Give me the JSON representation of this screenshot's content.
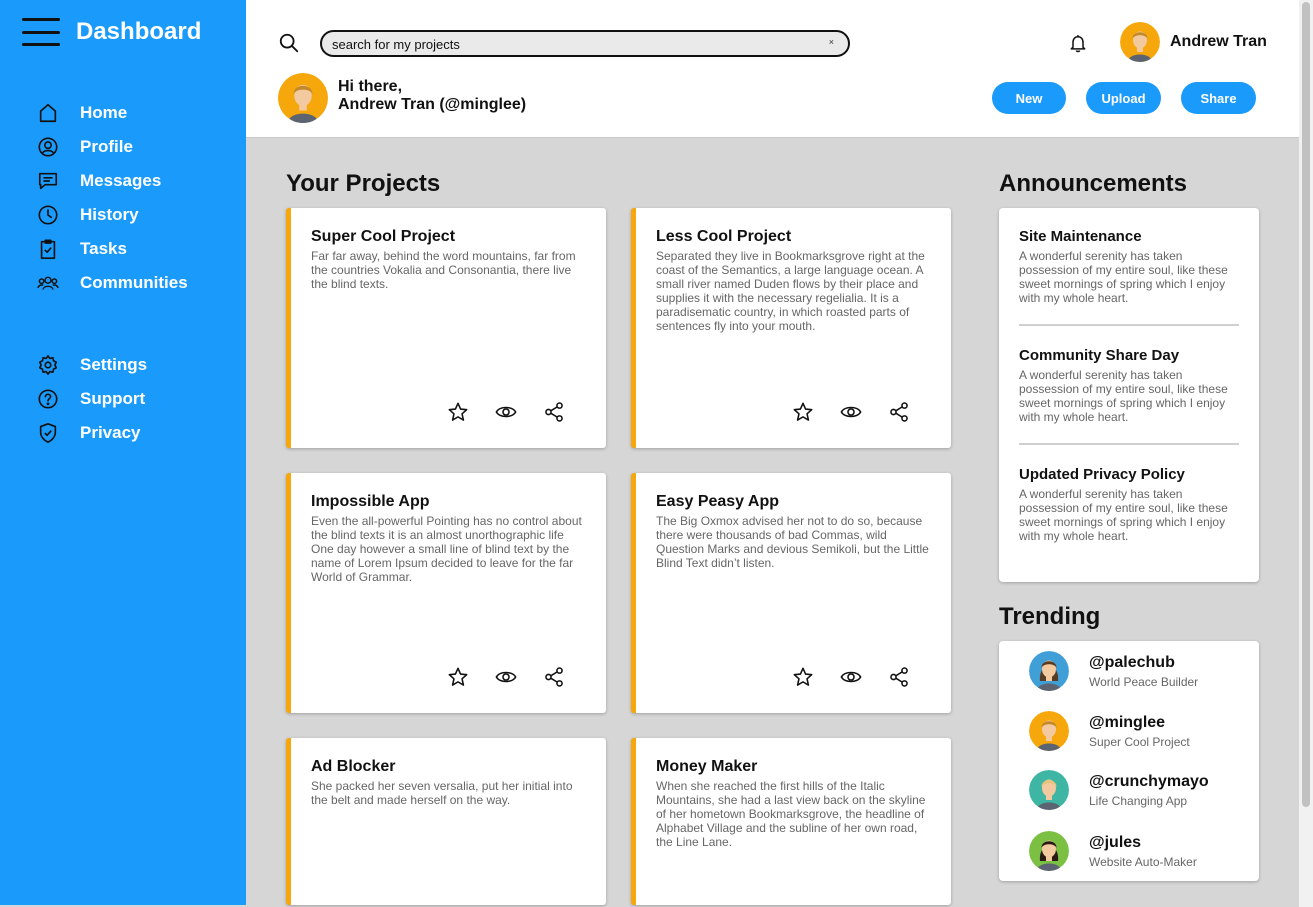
{
  "sidebar": {
    "title": "Dashboard",
    "main_items": [
      {
        "label": "Home",
        "icon": "home-icon"
      },
      {
        "label": "Profile",
        "icon": "profile-icon"
      },
      {
        "label": "Messages",
        "icon": "messages-icon"
      },
      {
        "label": "History",
        "icon": "history-icon"
      },
      {
        "label": "Tasks",
        "icon": "tasks-icon"
      },
      {
        "label": "Communities",
        "icon": "communities-icon"
      }
    ],
    "secondary_items": [
      {
        "label": "Settings",
        "icon": "gear-icon"
      },
      {
        "label": "Support",
        "icon": "help-icon"
      },
      {
        "label": "Privacy",
        "icon": "shield-icon"
      }
    ]
  },
  "header": {
    "search_value": "search for my projects",
    "search_clear": "×",
    "user_name": "Andrew Tran",
    "greeting_line1": "Hi there,",
    "greeting_line2": "Andrew Tran (@minglee)",
    "actions": [
      "New",
      "Upload",
      "Share"
    ]
  },
  "projects": {
    "title": "Your Projects",
    "items": [
      {
        "title": "Super Cool Project",
        "desc": "Far far away, behind the word mountains, far from the countries Vokalia and Consonantia, there live the blind texts."
      },
      {
        "title": "Less Cool Project",
        "desc": "Separated they live in Bookmarksgrove right at the coast of the Semantics, a large language ocean. A small river named Duden flows by their place and supplies it with the necessary regelialia. It is a paradisematic country, in which roasted parts of sentences fly into your mouth."
      },
      {
        "title": "Impossible App",
        "desc": "Even the all-powerful Pointing has no control about the blind texts it is an almost unorthographic life One day however a small line of blind text by the name of Lorem Ipsum decided to leave for the far World of Grammar."
      },
      {
        "title": "Easy Peasy App",
        "desc": "The Big Oxmox advised her not to do so, because there were thousands of bad Commas, wild Question Marks and devious Semikoli, but the Little Blind Text didn’t listen."
      },
      {
        "title": "Ad Blocker",
        "desc": "She packed her seven versalia, put her initial into the belt and made herself on the way."
      },
      {
        "title": "Money Maker",
        "desc": "When she reached the first hills of the Italic Mountains, she had a last view back on the skyline of her hometown Bookmarksgrove, the headline of Alphabet Village and the subline of her own road, the Line Lane."
      }
    ]
  },
  "announcements": {
    "title": "Announcements",
    "items": [
      {
        "title": "Site Maintenance",
        "body": "A wonderful serenity has taken possession of my entire soul, like these sweet mornings of spring which I enjoy with my whole heart."
      },
      {
        "title": "Community Share Day",
        "body": "A wonderful serenity has taken possession of my entire soul, like these sweet mornings of spring which I enjoy with my whole heart."
      },
      {
        "title": "Updated Privacy Policy",
        "body": "A wonderful serenity has taken possession of my entire soul, like these sweet mornings of spring which I enjoy with my whole heart."
      }
    ]
  },
  "trending": {
    "title": "Trending",
    "items": [
      {
        "handle": "@palechub",
        "project": "World Peace Builder",
        "avatar_bg": "#3f9fd6",
        "hair": "#5a3b22",
        "skin": "#f3c9a0"
      },
      {
        "handle": "@minglee",
        "project": "Super Cool Project",
        "avatar_bg": "#f5a70c",
        "hair": "#c48a2a",
        "skin": "#f3c9a0"
      },
      {
        "handle": "@crunchymayo",
        "project": "Life Changing App",
        "avatar_bg": "#3fb5a3",
        "hair": "#e6c47a",
        "skin": "#f3c9a0"
      },
      {
        "handle": "@jules",
        "project": "Website Auto-Maker",
        "avatar_bg": "#7cc043",
        "hair": "#2a1a14",
        "skin": "#f3c9a0"
      }
    ]
  },
  "colors": {
    "accent": "#1a9bfc",
    "card_border": "#f5a70c",
    "background": "#d6d6d6"
  }
}
